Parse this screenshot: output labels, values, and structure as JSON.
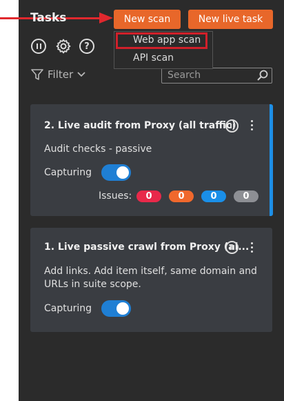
{
  "header": {
    "title": "Tasks",
    "new_scan_label": "New scan",
    "new_live_task_label": "New live task"
  },
  "dropdown": {
    "items": [
      {
        "label": "Web app scan"
      },
      {
        "label": "API scan"
      }
    ]
  },
  "toolbar": {
    "filter_label": "Filter",
    "search_placeholder": "Search"
  },
  "tasks": [
    {
      "title": "2. Live audit from Proxy (all traffic)",
      "description": "Audit checks - passive",
      "capturing_label": "Capturing",
      "capturing_on": true,
      "issues_label": "Issues:",
      "issues": [
        {
          "value": "0",
          "color": "#e8294a"
        },
        {
          "value": "0",
          "color": "#f0682c"
        },
        {
          "value": "0",
          "color": "#1a8fe8"
        },
        {
          "value": "0",
          "color": "#8d8f94"
        }
      ]
    },
    {
      "title": "1. Live passive crawl from Proxy (al...",
      "description_line1": "Add links. Add item itself, same domain and",
      "description_line2": "URLs in suite scope.",
      "capturing_label": "Capturing",
      "capturing_on": true
    }
  ],
  "colors": {
    "accent_orange": "#e8672a",
    "annotation_red": "#e0282e",
    "toggle_blue": "#1f7fd4",
    "selected_border_blue": "#1e8fe6"
  }
}
